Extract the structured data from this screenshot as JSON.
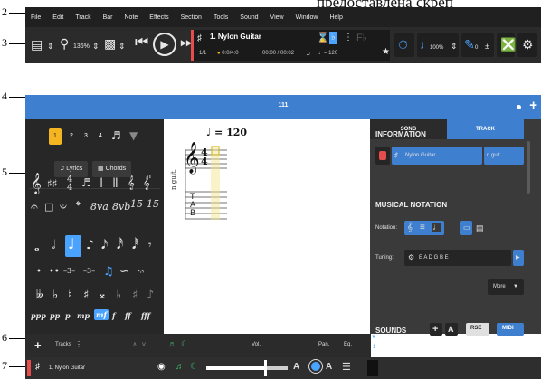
{
  "top_text": "предоставлена скреп",
  "callouts": [
    "2",
    "3",
    "4",
    "5",
    "6",
    "7"
  ],
  "menu": [
    "File",
    "Edit",
    "Track",
    "Bar",
    "Note",
    "Effects",
    "Section",
    "Tools",
    "Sound",
    "View",
    "Window",
    "Help"
  ],
  "toolbar": {
    "zoom": "136%",
    "track_name": "1. Nylon Guitar",
    "bar_position": "1/1",
    "beat_info": "0:0/4:0",
    "time": "00:00 / 00:02",
    "tempo": "♩= 120",
    "speed": "100%",
    "pitch": "0"
  },
  "tab": {
    "title": "111"
  },
  "left_panel": {
    "voices": [
      "1",
      "2",
      "3",
      "4"
    ],
    "lyrics_label": "Lyrics",
    "chords_label": "Chords",
    "dynamics": [
      "ppp",
      "pp",
      "p",
      "mp",
      "mf",
      "f",
      "ff",
      "fff"
    ],
    "active_dynamic": "mf"
  },
  "score": {
    "tempo_label": "= 120",
    "time_signature": [
      "4",
      "4"
    ],
    "instrument_label": "n.guit.",
    "tab_letters": [
      "T",
      "A",
      "B"
    ]
  },
  "right_panel": {
    "tabs": [
      "SONG",
      "TRACK"
    ],
    "active_tab": "TRACK",
    "information_heading": "INFORMATION",
    "track_name_value": "Nylon Guitar",
    "track_short_value": "n.guit.",
    "musical_notation_heading": "MUSICAL NOTATION",
    "notation_label": "Notation:",
    "tuning_label": "Tuning:",
    "tuning_value": "E A D G B E",
    "more_label": "More",
    "sounds_heading": "SOUNDS",
    "rse_label": "RSE",
    "midi_label": "MIDI"
  },
  "track_header": {
    "tracks_label": "Tracks",
    "vol_label": "Vol.",
    "pan_label": "Pan.",
    "eq_label": "Eq.",
    "marker": "1"
  },
  "track_row": {
    "name": "1. Nylon Guitar",
    "volume_fraction": 0.72
  },
  "colors": {
    "accent_blue": "#3f7fd0",
    "highlight_blue": "#4aa3ff",
    "voice_yellow": "#f4b521",
    "track_red": "#e74c4c"
  }
}
